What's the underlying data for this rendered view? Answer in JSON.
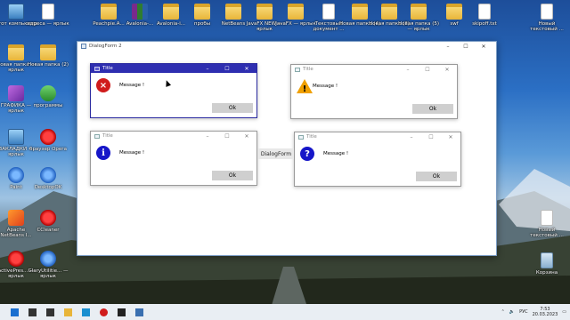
{
  "desktop": {
    "icons_left": [
      {
        "label": "Этот компьютер",
        "kind": "pc"
      },
      {
        "label": "адреса — ярлык",
        "kind": "doc"
      },
      {
        "label": "Новая папка — ярлык",
        "kind": "folder"
      },
      {
        "label": "Новая папка (2)",
        "kind": "folder"
      },
      {
        "label": "ГРАФИКА — ярлык",
        "kind": "purple"
      },
      {
        "label": "программы",
        "kind": "green"
      },
      {
        "label": "ЗАКЛАДКИ — ярлык",
        "kind": "pc"
      },
      {
        "label": "браузер Opera",
        "kind": "red"
      },
      {
        "label": "Paint",
        "kind": "blue"
      },
      {
        "label": "DesktopOK",
        "kind": "blue"
      },
      {
        "label": "Apache NetBeans I...",
        "kind": "orange"
      },
      {
        "label": "CCleaner",
        "kind": "red"
      },
      {
        "label": "ActivePres... — ярлык",
        "kind": "red"
      },
      {
        "label": "GlaryUtilitie... — ярлык",
        "kind": "blue"
      }
    ],
    "icons_top": [
      {
        "label": "Peachpie.A...",
        "kind": "folder"
      },
      {
        "label": "Avalonia-...",
        "kind": "winrar"
      },
      {
        "label": "Avalonia-i...",
        "kind": "folder"
      },
      {
        "label": "пробы",
        "kind": "folder"
      },
      {
        "label": "NetBeans",
        "kind": "folder"
      },
      {
        "label": "JavaFX NEW — ярлык",
        "kind": "folder"
      },
      {
        "label": "JavaFX — ярлык",
        "kind": "folder"
      },
      {
        "label": "Текстовый документ ...",
        "kind": "doc"
      },
      {
        "label": "Новая папка (4)",
        "kind": "folder"
      },
      {
        "label": "Новая папка (3)",
        "kind": "folder"
      },
      {
        "label": "Новая папка (5) — ярлык",
        "kind": "folder"
      },
      {
        "label": "swf",
        "kind": "folder"
      },
      {
        "label": "skipoff.txt",
        "kind": "doc"
      },
      {
        "label": "Новый текстовый ...",
        "kind": "doc"
      }
    ],
    "icons_right": [
      {
        "label": "Новый текстовый ...",
        "kind": "doc"
      },
      {
        "label": "Корзина",
        "kind": "recycle"
      }
    ]
  },
  "main_window": {
    "title": "DialogForm 2",
    "controls": [
      "–",
      "☐",
      "✕"
    ]
  },
  "dialog_form_label": "DialogForm",
  "dialogs": [
    {
      "id": "error",
      "title": "Title",
      "message": "Message !",
      "ok_label": "Ok",
      "icon": "×",
      "icon_type": "err",
      "active": true
    },
    {
      "id": "warning",
      "title": "Title",
      "message": "Message !",
      "ok_label": "Ok",
      "icon": "!",
      "icon_type": "warn",
      "active": false
    },
    {
      "id": "info",
      "title": "Title",
      "message": "Message !",
      "ok_label": "Ok",
      "icon": "i",
      "icon_type": "info",
      "active": false
    },
    {
      "id": "question",
      "title": "Title",
      "message": "Message !",
      "ok_label": "Ok",
      "icon": "?",
      "icon_type": "q",
      "active": false
    }
  ],
  "taskbar": {
    "items": [
      "windows-start-icon",
      "search-icon",
      "task-view-icon",
      "file-explorer-icon",
      "edge-icon",
      "opera-icon",
      "terminal-icon",
      "app-window-icon"
    ],
    "language": "РУС",
    "time": "7:53",
    "date": "20.03.2023"
  },
  "colors": {
    "active_title": "#2e2eb0",
    "error_icon": "#d01c1c",
    "info_icon": "#1616c8",
    "warning_icon": "#f0a000",
    "ok_button": "#cfcfcf"
  }
}
